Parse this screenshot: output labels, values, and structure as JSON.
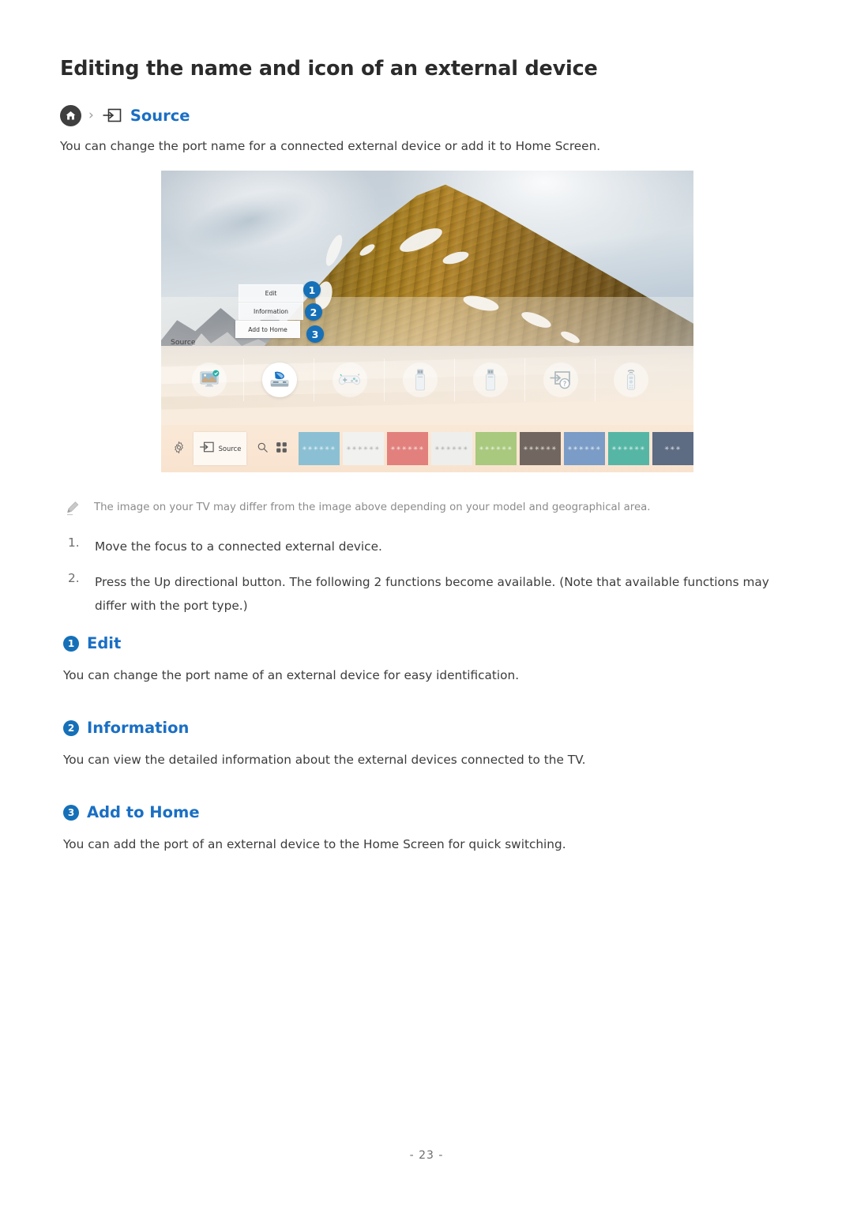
{
  "document": {
    "title": "Editing the name and icon of an external device",
    "intro": "You can change the port name for a connected external device or add it to Home Screen.",
    "page_number": "- 23 -"
  },
  "breadcrumb": {
    "home_icon": "home-icon",
    "separator": "›",
    "source_icon": "source-input-icon",
    "label": "Source"
  },
  "tv_screenshot": {
    "source_label": "Source",
    "menu": [
      {
        "label": "Edit",
        "callout": "1"
      },
      {
        "label": "Information",
        "callout": "2"
      },
      {
        "label": "Add to Home",
        "callout": "3"
      }
    ],
    "devices": [
      {
        "name": "tv-icon",
        "label": "TV",
        "active": false,
        "badge": true
      },
      {
        "name": "blu-ray-player-icon",
        "label": "Blu-ray player",
        "active": true,
        "badge": false
      },
      {
        "name": "game-controller-icon",
        "label": "Game console",
        "active": false,
        "badge": false
      },
      {
        "name": "usb-drive-icon",
        "label": "USB 1",
        "active": false,
        "badge": false
      },
      {
        "name": "usb-drive-icon",
        "label": "USB 2",
        "active": false,
        "badge": false
      },
      {
        "name": "connection-guide-icon",
        "label": "Connection Guide",
        "active": false,
        "badge": false
      },
      {
        "name": "remote-control-icon",
        "label": "Universal Remote",
        "active": false,
        "badge": false
      }
    ],
    "bottom_bar": {
      "settings_icon": "gear-icon",
      "source_button": {
        "icon": "source-input-icon",
        "label": "Source"
      },
      "search_icon": "search-icon",
      "apps_icon": "apps-grid-icon",
      "tiles": [
        {
          "bg": "#8bc0d4",
          "fg": "#ffffff",
          "label": "✳✳✳✳✳✳"
        },
        {
          "bg": "#f1f1ef",
          "fg": "#9a9a9a",
          "label": "✳✳✳✳✳✳"
        },
        {
          "bg": "#e1807c",
          "fg": "#ffffff",
          "label": "✳✳✳✳✳✳"
        },
        {
          "bg": "#eeeeec",
          "fg": "#9a9a9a",
          "label": "✳✳✳✳✳✳"
        },
        {
          "bg": "#a8c97e",
          "fg": "#ffffff",
          "label": "✳✳✳✳✳✳"
        },
        {
          "bg": "#716760",
          "fg": "#ffffff",
          "label": "✳✳✳✳✳✳"
        },
        {
          "bg": "#7a9cc6",
          "fg": "#ffffff",
          "label": "✳✳✳✳✳✳"
        },
        {
          "bg": "#56b6a6",
          "fg": "#ffffff",
          "label": "✳✳✳✳✳✳"
        },
        {
          "bg": "#5d6b83",
          "fg": "#ffffff",
          "label": "✳✳✳"
        }
      ]
    }
  },
  "note": {
    "icon": "pencil-icon",
    "text": "The image on your TV may differ from the image above depending on your model and geographical area."
  },
  "steps": [
    {
      "num": "1.",
      "text": "Move the focus to a connected external device."
    },
    {
      "num": "2.",
      "text": "Press the Up directional button. The following 2 functions become available. (Note that available functions may differ with the port type.)"
    }
  ],
  "sections": [
    {
      "badge": "1",
      "title": "Edit",
      "body": "You can change the port name of an external device for easy identification."
    },
    {
      "badge": "2",
      "title": "Information",
      "body": "You can view the detailed information about the external devices connected to the TV."
    },
    {
      "badge": "3",
      "title": "Add to Home",
      "body": "You can add the port of an external device to the Home Screen for quick switching."
    }
  ],
  "colors": {
    "link_blue": "#1a6fc4",
    "badge_blue": "#1570b8",
    "body_text": "#3c3c3c",
    "muted_text": "#8b8b8b"
  }
}
